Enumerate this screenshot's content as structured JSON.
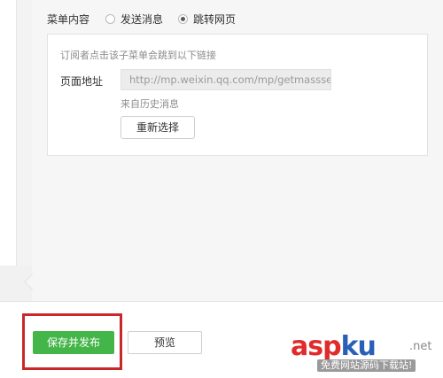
{
  "menu": {
    "content_label": "菜单内容",
    "options": [
      {
        "label": "发送消息",
        "selected": false
      },
      {
        "label": "跳转网页",
        "selected": true
      }
    ]
  },
  "link": {
    "hint": "订阅者点击该子菜单会跳到以下链接",
    "address_label": "页面地址",
    "address_value": "http://mp.weixin.qq.com/mp/getmasssen",
    "source_text": "来自历史消息",
    "reselect_label": "重新选择"
  },
  "footer": {
    "save_publish_label": "保存并发布",
    "preview_label": "预览",
    "save_color": "#44b549",
    "highlight_color": "#c9282a"
  },
  "watermark": {
    "brand_asp": "asp",
    "brand_ku": "ku",
    "tld": ".net",
    "slogan": "免费网站源码下载站!"
  }
}
